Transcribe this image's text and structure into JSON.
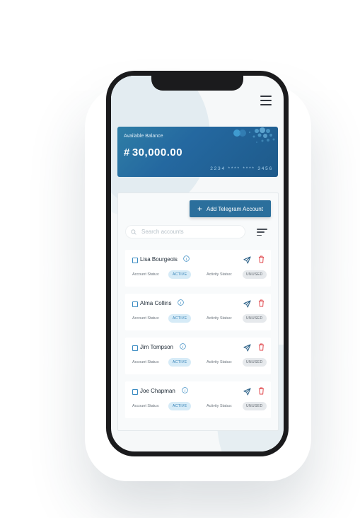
{
  "menu": {
    "icon": "hamburger-menu-icon"
  },
  "balance_card": {
    "label": "Available Balance",
    "currency_symbol": "#",
    "amount": "30,000.00",
    "card_number": "2234 **** **** 3456"
  },
  "toolbar": {
    "add_button_label": "Add Telegram Account",
    "add_icon": "plus-icon",
    "search_placeholder": "Search accounts",
    "filter_icon": "filter-sort-icon"
  },
  "accounts": [
    {
      "name": "Lisa Bourgeois",
      "account_status_label": "Account Status:",
      "account_status": "ACTIVE",
      "activity_status_label": "Activity Status:",
      "activity_status": "UNUSED"
    },
    {
      "name": "Alma Collins",
      "account_status_label": "Account Status:",
      "account_status": "ACTIVE",
      "activity_status_label": "Activity Status:",
      "activity_status": "UNUSED"
    },
    {
      "name": "Jim Tompson",
      "account_status_label": "Account Status:",
      "account_status": "ACTIVE",
      "activity_status_label": "Activity Status:",
      "activity_status": "UNUSED"
    },
    {
      "name": "Joe Chapman",
      "account_status_label": "Account Status:",
      "account_status": "ACTIVE",
      "activity_status_label": "Activity Status:",
      "activity_status": "UNUSED"
    }
  ],
  "colors": {
    "accent": "#2b6f9c",
    "card_gradient_start": "#2f7ea6",
    "card_gradient_end": "#1e5a8a",
    "delete": "#e0454a",
    "active_badge_bg": "#d6ebf7",
    "unused_badge_bg": "#e6e9ec"
  }
}
